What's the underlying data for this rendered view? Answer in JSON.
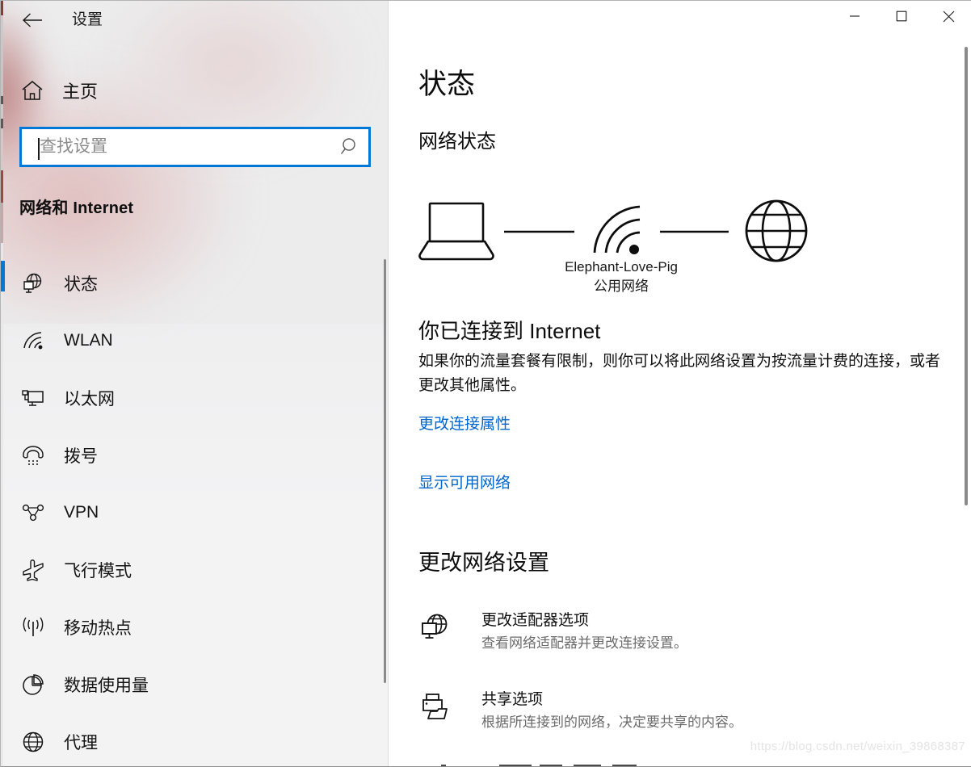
{
  "window": {
    "title": "设置",
    "controls": {
      "minimize": "minimize-icon",
      "maximize": "maximize-icon",
      "close": "close-icon"
    }
  },
  "sidebar": {
    "back_icon": "back-arrow-icon",
    "home": {
      "label": "主页",
      "icon": "home-icon"
    },
    "search": {
      "value": "",
      "placeholder": "查找设置",
      "icon": "search-icon"
    },
    "section_header": "网络和 Internet",
    "selected_index": 0,
    "items": [
      {
        "label": "状态",
        "icon": "network-status-icon",
        "selected": true
      },
      {
        "label": "WLAN",
        "icon": "wifi-icon",
        "selected": false
      },
      {
        "label": "以太网",
        "icon": "ethernet-icon",
        "selected": false
      },
      {
        "label": "拨号",
        "icon": "dialup-phone-icon",
        "selected": false
      },
      {
        "label": "VPN",
        "icon": "vpn-icon",
        "selected": false
      },
      {
        "label": "飞行模式",
        "icon": "airplane-icon",
        "selected": false
      },
      {
        "label": "移动热点",
        "icon": "hotspot-icon",
        "selected": false
      },
      {
        "label": "数据使用量",
        "icon": "pie-chart-icon",
        "selected": false
      },
      {
        "label": "代理",
        "icon": "globe-icon",
        "selected": false
      }
    ]
  },
  "main": {
    "page_title": "状态",
    "sub_title": "网络状态",
    "diagram": {
      "device_icon": "laptop-icon",
      "wifi_icon": "wifi-signal-icon",
      "internet_icon": "globe-icon",
      "ssid": "Elephant-Love-Pig",
      "network_type": "公用网络"
    },
    "connection": {
      "heading": "你已连接到 Internet",
      "description": "如果你的流量套餐有限制，则你可以将此网络设置为按流量计费的连接，或者更改其他属性。",
      "link_properties": "更改连接属性",
      "link_available": "显示可用网络"
    },
    "change_settings": {
      "heading": "更改网络设置",
      "options": [
        {
          "title": "更改适配器选项",
          "subtitle": "查看网络适配器并更改连接设置。",
          "icon": "adapter-globe-icon"
        },
        {
          "title": "共享选项",
          "subtitle": "根据所连接到的网络，决定要共享的内容。",
          "icon": "sharing-printer-folder-icon"
        }
      ]
    }
  },
  "watermark": "https://blog.csdn.net/weixin_39868387",
  "colors": {
    "accent": "#0078d7",
    "link": "#0066cc",
    "sidebar_bg": "#ececed",
    "main_bg": "#ffffff",
    "muted_text": "#6b6b6b"
  }
}
